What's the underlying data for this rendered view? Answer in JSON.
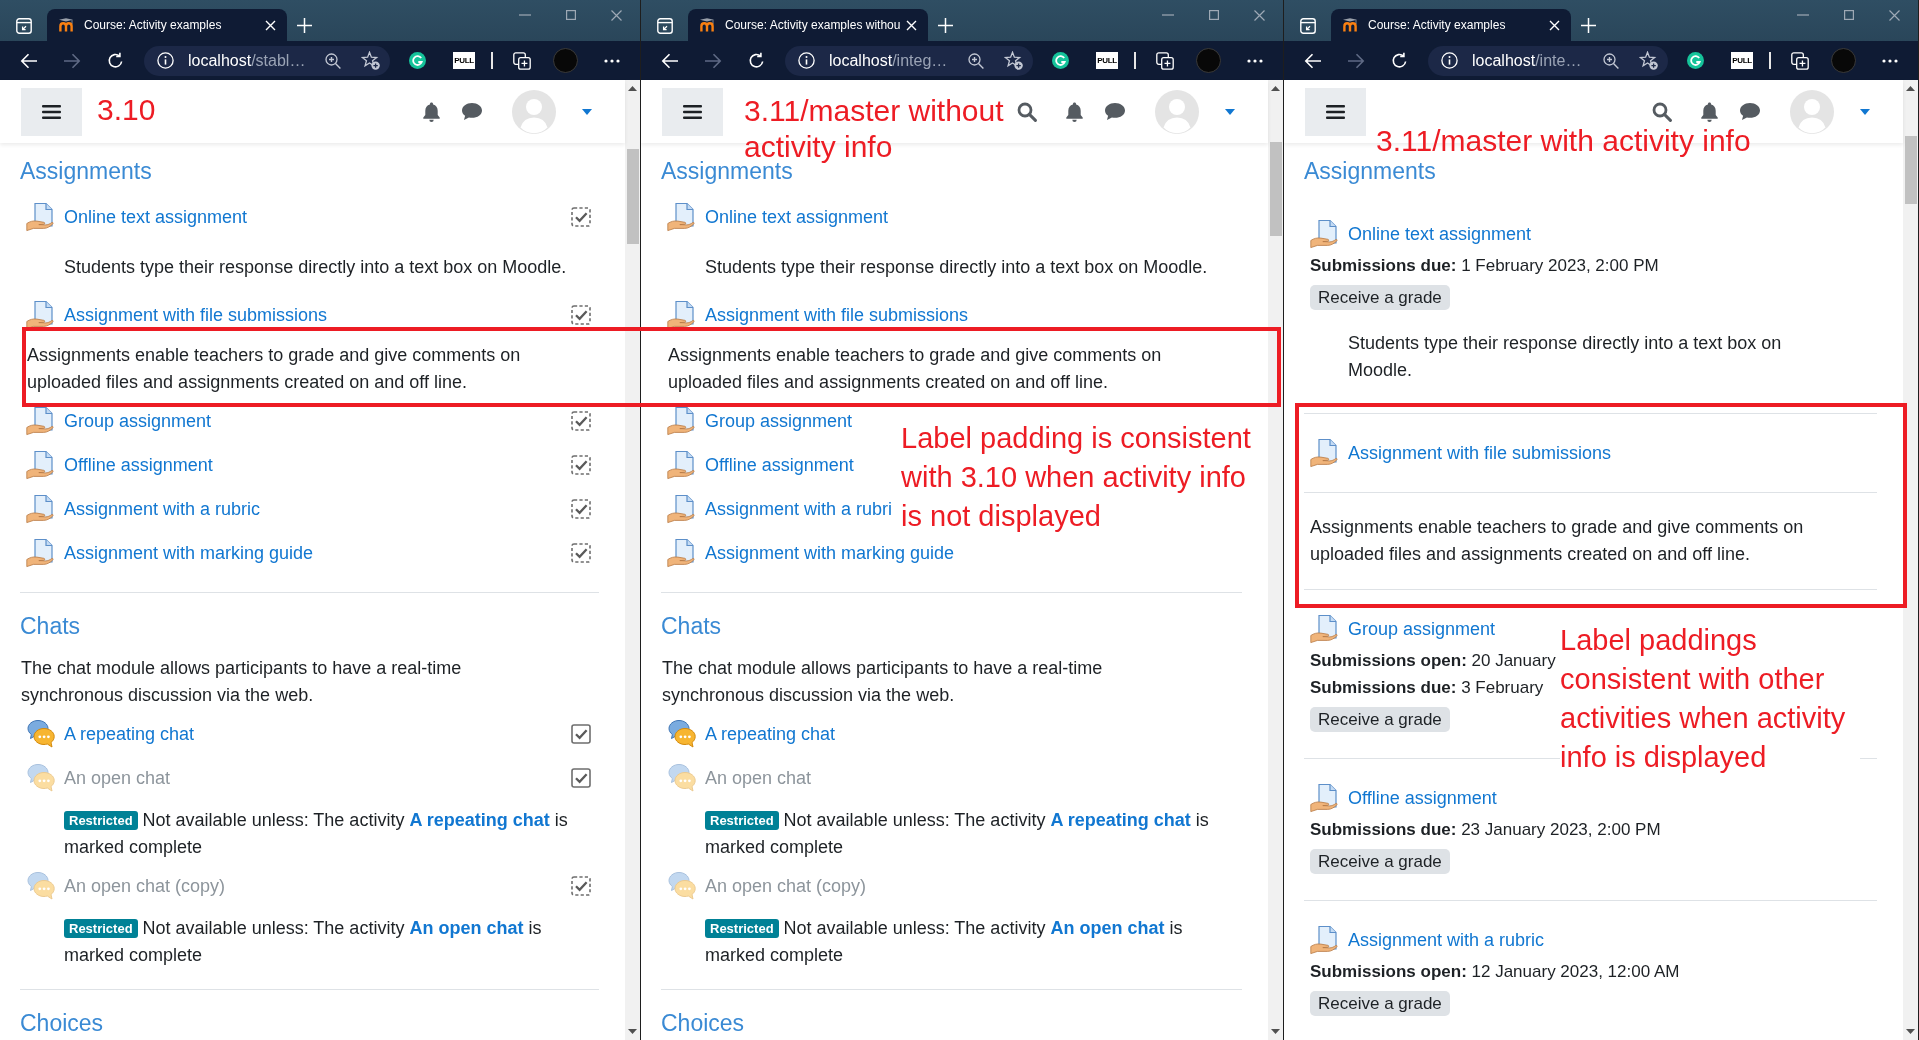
{
  "windows": [
    {
      "kind": "classic",
      "tabs": [
        {
          "title": "Course: Activity examples",
          "selected": true
        }
      ],
      "toolbar": {
        "host": "localhost",
        "path": "/stabl…",
        "extension_label": "PULL"
      },
      "navbar": {
        "search": false
      },
      "version_label": "3.10",
      "sections": [
        {
          "title": "Assignments",
          "items": [
            {
              "kind": "assignment",
              "name": "Online text assignment",
              "dimmed": false,
              "completion": {
                "kind": "auto",
                "checked": true
              },
              "description": "Students type their response directly into a text box on Moodle."
            },
            {
              "kind": "assignment",
              "name": "Assignment with file submissions",
              "dimmed": false,
              "completion": {
                "kind": "auto",
                "checked": true
              }
            },
            {
              "kind": "label",
              "text": "Assignments enable teachers to grade and give comments on uploaded files and assignments created on and off line."
            },
            {
              "kind": "assignment",
              "name": "Group assignment",
              "dimmed": false,
              "completion": {
                "kind": "auto",
                "checked": true
              }
            },
            {
              "kind": "assignment",
              "name": "Offline assignment",
              "dimmed": false,
              "completion": {
                "kind": "auto",
                "checked": true
              }
            },
            {
              "kind": "assignment",
              "name": "Assignment with a rubric",
              "dimmed": false,
              "completion": {
                "kind": "auto",
                "checked": true
              }
            },
            {
              "kind": "assignment",
              "name": "Assignment with marking guide",
              "dimmed": false,
              "completion": {
                "kind": "auto",
                "checked": true
              }
            }
          ]
        },
        {
          "title": "Chats",
          "summary": "The chat module allows participants to have a real-time synchronous discussion via the web.",
          "items": [
            {
              "kind": "chat",
              "name": "A repeating chat",
              "dimmed": false,
              "completion": {
                "kind": "manual",
                "checked": true
              }
            },
            {
              "kind": "chat",
              "name": "An open chat",
              "dimmed": true,
              "completion": {
                "kind": "manual",
                "checked": true
              },
              "restriction": {
                "badge": "Restricted",
                "before": "Not available unless: The activity",
                "link": "A repeating chat",
                "after": "is marked complete"
              }
            },
            {
              "kind": "chat",
              "name": "An open chat (copy)",
              "dimmed": true,
              "completion": {
                "kind": "auto",
                "checked": true
              },
              "restriction": {
                "badge": "Restricted",
                "before": "Not available unless: The activity",
                "link": "An open chat",
                "after": "is marked complete"
              }
            }
          ]
        },
        {
          "title": "Choices"
        }
      ]
    },
    {
      "kind": "classic",
      "tabs": [
        {
          "title": "Course: Activity examples withou",
          "selected": true
        }
      ],
      "toolbar": {
        "host": "localhost",
        "path": "/integ…",
        "extension_label": "PULL"
      },
      "navbar": {
        "search": true
      },
      "version_label": "3.11/master without activity info",
      "note": "Label padding is consistent with 3.10 when activity info is not displayed",
      "sections": [
        {
          "title": "Assignments",
          "items": [
            {
              "kind": "assignment",
              "name": "Online text assignment",
              "dimmed": false,
              "description": "Students type their response directly into a text box on Moodle."
            },
            {
              "kind": "assignment",
              "name": "Assignment with file submissions",
              "dimmed": false
            },
            {
              "kind": "label",
              "text": "Assignments enable teachers to grade and give comments on uploaded files and assignments created on and off line."
            },
            {
              "kind": "assignment",
              "name": "Group assignment",
              "dimmed": false
            },
            {
              "kind": "assignment",
              "name": "Offline assignment",
              "dimmed": false
            },
            {
              "kind": "assignment",
              "name": "Assignment with a rubri",
              "dimmed": false
            },
            {
              "kind": "assignment",
              "name": "Assignment with marking guide",
              "dimmed": false
            }
          ]
        },
        {
          "title": "Chats",
          "summary": "The chat module allows participants to have a real-time synchronous discussion via the web.",
          "items": [
            {
              "kind": "chat",
              "name": "A repeating chat",
              "dimmed": false
            },
            {
              "kind": "chat",
              "name": "An open chat",
              "dimmed": true,
              "restriction": {
                "badge": "Restricted",
                "before": "Not available unless: The activity",
                "link": "A repeating chat",
                "after": "is marked complete"
              }
            },
            {
              "kind": "chat",
              "name": "An open chat (copy)",
              "dimmed": true,
              "restriction": {
                "badge": "Restricted",
                "before": "Not available unless: The activity",
                "link": "An open chat",
                "after": "is marked complete"
              }
            }
          ]
        },
        {
          "title": "Choices"
        }
      ]
    },
    {
      "kind": "activity_info",
      "tabs": [
        {
          "title": "Course: Activity examples",
          "selected": true
        }
      ],
      "toolbar": {
        "host": "localhost",
        "path": "/inte…",
        "extension_label": "PULL"
      },
      "navbar": {
        "search": true
      },
      "version_label": "3.11/master with activity info",
      "note": "Label paddings consistent with other activities when activity info is displayed",
      "sections": [
        {
          "title": "Assignments",
          "items": [
            {
              "kind": "assignment",
              "name": "Online text assignment",
              "dimmed": false,
              "dates": [
                "**Submissions due:** 1 February 2023, 2:00 PM"
              ],
              "badge": "Receive a grade",
              "description": "Students type their response directly into a text box on Moodle."
            },
            {
              "kind": "assignment",
              "name": "Assignment with file submissions",
              "dimmed": false
            },
            {
              "kind": "label",
              "text": "Assignments enable teachers to grade and give comments on uploaded files and assignments created on and off line."
            },
            {
              "kind": "assignment",
              "name": "Group assignment",
              "dimmed": false,
              "dates": [
                "**Submissions open:** 20 January",
                "**Submissions due:** 3 February"
              ],
              "badge": "Receive a grade"
            },
            {
              "kind": "assignment",
              "name": "Offline assignment",
              "dimmed": false,
              "dates": [
                "**Submissions due:** 23 January 2023, 2:00 PM"
              ],
              "badge": "Receive a grade"
            },
            {
              "kind": "assignment",
              "name": "Assignment with a rubric",
              "dimmed": false,
              "dates": [
                "**Submissions open:** 12 January 2023, 12:00 AM"
              ],
              "badge": "Receive a grade"
            }
          ]
        }
      ]
    }
  ]
}
